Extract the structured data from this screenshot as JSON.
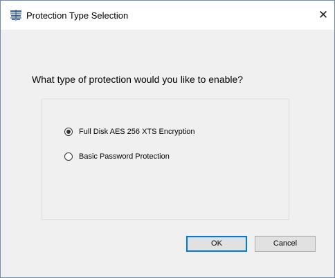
{
  "window": {
    "title": "Protection Type Selection",
    "icon": "disk-encryption-app-icon",
    "close_glyph": "✕"
  },
  "main": {
    "question": "What type of protection would you like to enable?",
    "options": [
      {
        "label": "Full Disk AES 256 XTS Encryption",
        "selected": true
      },
      {
        "label": "Basic Password Protection",
        "selected": false
      }
    ]
  },
  "buttons": {
    "ok_label": "OK",
    "cancel_label": "Cancel"
  },
  "colors": {
    "accent": "#0078d7",
    "window_background": "#f0f0f0",
    "titlebar_background": "#ffffff",
    "window_border": "#6d8bb2"
  }
}
